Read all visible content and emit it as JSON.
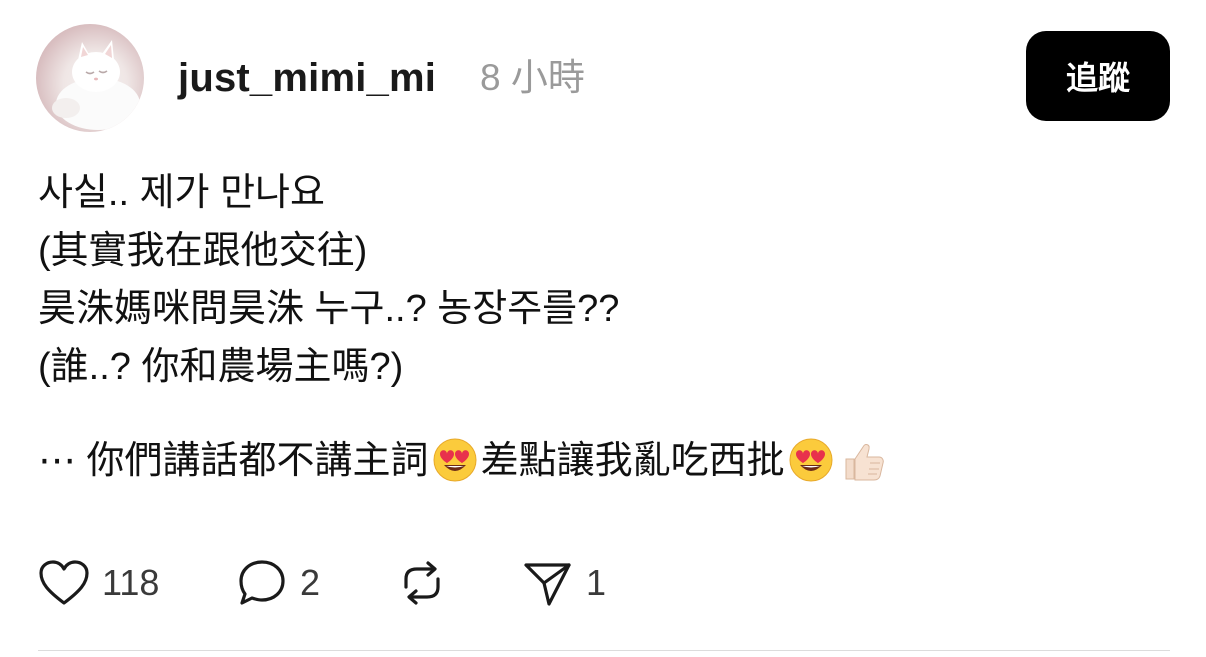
{
  "post": {
    "username": "just_mimi_mi",
    "timestamp": "8 小時",
    "follow_label": "追蹤",
    "lines": [
      "사실.. 제가 만나요",
      "(其實我在跟他交往)",
      "昊洙媽咪問昊洙 누구..? 농장주를??",
      "(誰..? 你和農場主嗎?)"
    ],
    "last_line": {
      "part1": "⋯ 你們講話都不講主詞",
      "part2": "差點讓我亂吃西批"
    },
    "emoji": {
      "heart_eyes": "heart-eyes-emoji",
      "thumbs_up": "thumbs-up-emoji"
    }
  },
  "actions": {
    "like_count": "118",
    "comment_count": "2",
    "share_count": "1"
  },
  "icons": {
    "like": "heart-icon",
    "comment": "comment-bubble-icon",
    "repost": "repost-icon",
    "share": "send-icon"
  },
  "colors": {
    "text": "#111111",
    "muted": "#9a9a9a",
    "follow_bg": "#000000",
    "follow_text": "#ffffff",
    "emoji_yellow": "#FBCB3C",
    "emoji_heart": "#E8314C"
  }
}
